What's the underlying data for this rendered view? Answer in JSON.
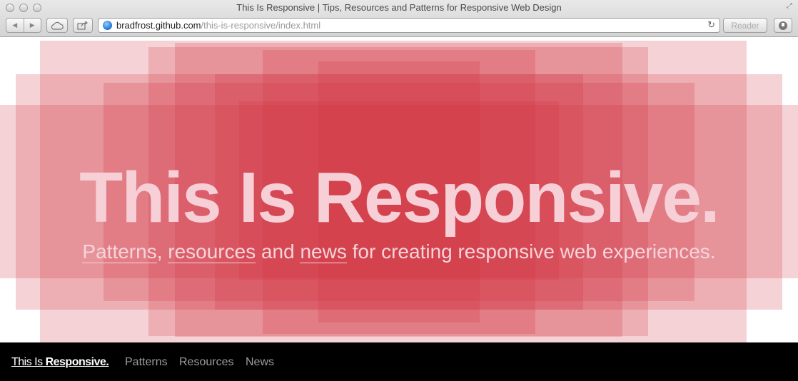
{
  "window": {
    "title": "This Is Responsive | Tips, Resources and Patterns for Responsive Web Design"
  },
  "toolbar": {
    "back_icon": "◀",
    "forward_icon": "▶",
    "cloud_icon": "cloud-icon",
    "share_icon": "share-icon",
    "url_host": "bradfrost.github.com",
    "url_path": "/this-is-responsive/index.html",
    "reload_icon": "↻",
    "reader_label": "Reader",
    "download_icon": "download-icon"
  },
  "hero": {
    "title": "This Is Responsive.",
    "subtitle": {
      "link1": "Patterns",
      "sep1": ", ",
      "link2": "resources",
      "mid": " and ",
      "link3": "news",
      "rest": " for creating responsive web experiences."
    },
    "accent_color": "#d2323f"
  },
  "nav": {
    "brand_light": "This Is ",
    "brand_bold": "Responsive.",
    "links": [
      "Patterns",
      "Resources",
      "News"
    ]
  }
}
